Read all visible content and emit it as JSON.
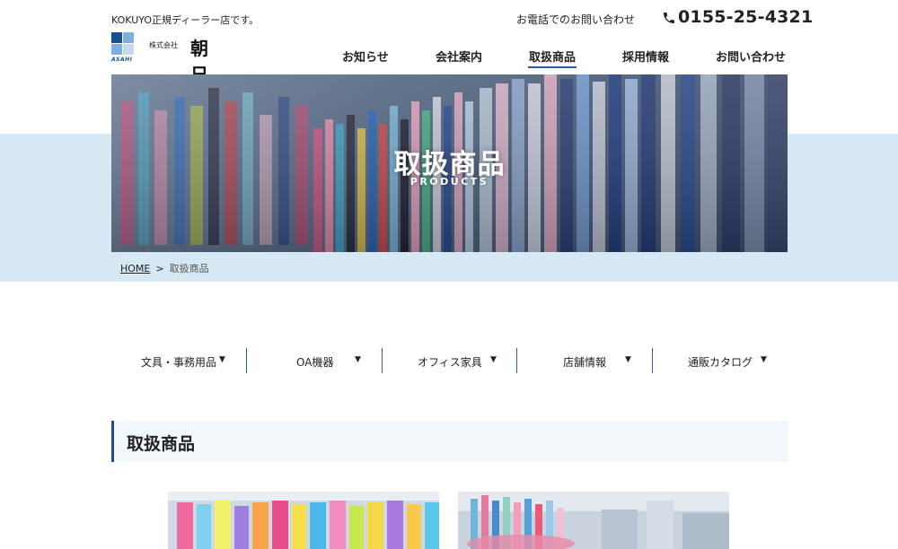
{
  "header": {
    "tagline": "KOKUYO正規ディーラー店です。",
    "logo": {
      "english": "ASAHI",
      "sub": "株式会社",
      "japanese": "朝日"
    },
    "phone_label": "お電話でのお問い合わせ",
    "phone_icon": "phone-icon",
    "phone_number": "0155-25-4321"
  },
  "nav": {
    "items": [
      {
        "label": "お知らせ",
        "active": false
      },
      {
        "label": "会社案内",
        "active": false
      },
      {
        "label": "取扱商品",
        "active": true
      },
      {
        "label": "採用情報",
        "active": false
      },
      {
        "label": "お問い合わせ",
        "active": false
      }
    ]
  },
  "hero": {
    "title": "取扱商品",
    "subtitle": "PRODUCTS"
  },
  "breadcrumb": {
    "home": "HOME",
    "separator": ">",
    "current": "取扱商品"
  },
  "categories": [
    {
      "label": "文具・事務用品",
      "icon": "triangle-down-icon"
    },
    {
      "label": "OA機器",
      "icon": "triangle-down-icon"
    },
    {
      "label": "オフィス家具",
      "icon": "triangle-down-icon"
    },
    {
      "label": "店舗情報",
      "icon": "triangle-down-icon"
    },
    {
      "label": "通販カタログ",
      "icon": "triangle-down-icon"
    }
  ],
  "section": {
    "title": "取扱商品"
  },
  "colors": {
    "accent": "#1f4f8f",
    "band": "#d6e8f3",
    "section_bg": "#f1f7fb"
  }
}
